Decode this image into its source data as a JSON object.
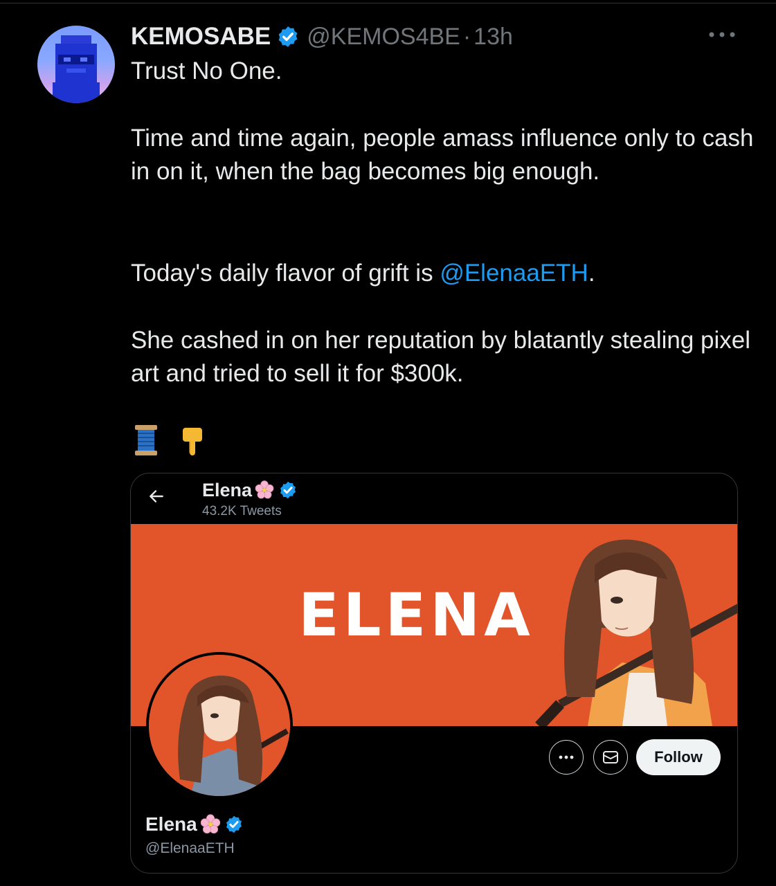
{
  "tweet": {
    "author_name": "KEMOSABE",
    "handle": "@KEMOS4BE",
    "separator": "·",
    "time": "13h",
    "lines": {
      "l1": "Trust No One.",
      "p2": "Time and time again, people amass influence only to cash in on it, when the bag becomes big enough.",
      "p3_before": "Today's daily flavor of grift is ",
      "p3_mention": "@ElenaaETH",
      "p3_after": ".",
      "p4": "She cashed in on her reputation by blatantly stealing pixel art and tried to sell it for $300k."
    },
    "emojis": [
      "🧵",
      "👇"
    ],
    "icons": [
      "verified-badge-icon",
      "more-options-icon"
    ]
  },
  "embed": {
    "header_name": "Elena",
    "header_sub": "43.2K Tweets",
    "banner_text": "ELENA",
    "profile_name": "Elena",
    "profile_handle": "@ElenaaETH",
    "follow_label": "Follow",
    "icons": [
      "back-arrow-icon",
      "cherry-blossom-icon",
      "verified-badge-icon",
      "more-icon",
      "message-icon"
    ]
  },
  "colors": {
    "background": "#000000",
    "text": "#e7e9ea",
    "secondary": "#71767b",
    "mention": "#1d9bf0",
    "banner": "#e2552a",
    "verified": "#1d9bf0"
  }
}
